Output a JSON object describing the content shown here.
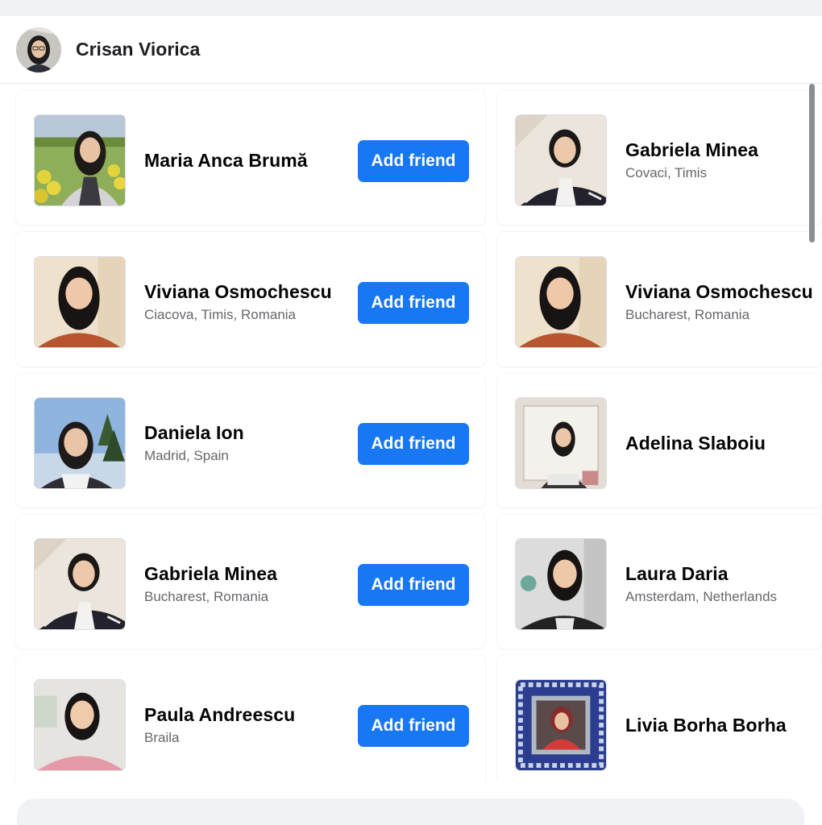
{
  "header": {
    "name": "Crisan Viorica"
  },
  "suggestions": [
    {
      "name": "Maria Anca Brumă",
      "location": "",
      "button": "Add friend"
    },
    {
      "name": "Gabriela Minea",
      "location": "Covaci, Timis",
      "button": ""
    },
    {
      "name": "Viviana Osmochescu",
      "location": "Ciacova, Timis, Romania",
      "button": "Add friend"
    },
    {
      "name": "Viviana Osmochescu",
      "location": "Bucharest, Romania",
      "button": ""
    },
    {
      "name": "Daniela Ion",
      "location": "Madrid, Spain",
      "button": "Add friend"
    },
    {
      "name": "Adelina Slaboiu",
      "location": "",
      "button": ""
    },
    {
      "name": "Gabriela Minea",
      "location": "Bucharest, Romania",
      "button": "Add friend"
    },
    {
      "name": "Laura Daria",
      "location": "Amsterdam, Netherlands",
      "button": ""
    },
    {
      "name": "Paula Andreescu",
      "location": "Braila",
      "button": "Add friend"
    },
    {
      "name": "Livia Borha Borha",
      "location": "",
      "button": ""
    }
  ],
  "colors": {
    "accent": "#1877f2",
    "secondary_text": "#65676b"
  }
}
